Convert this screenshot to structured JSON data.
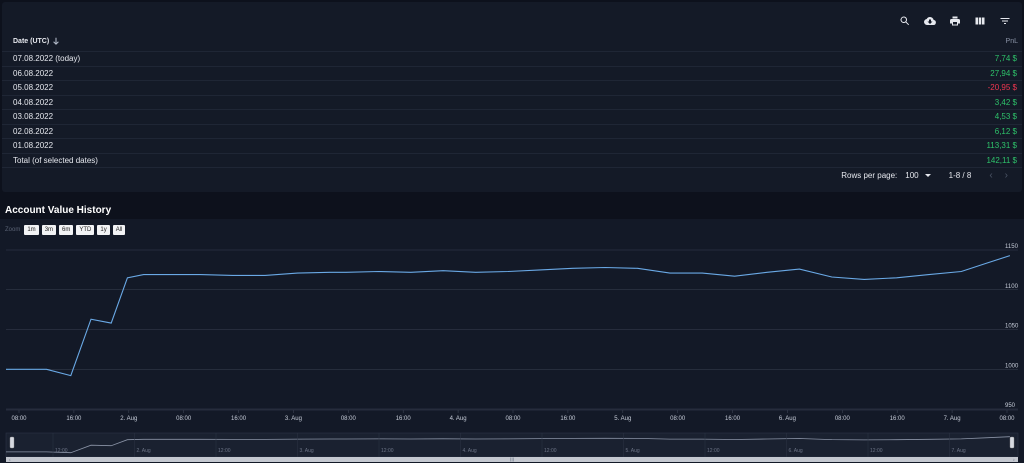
{
  "toolbar": {
    "icons": [
      "search-icon",
      "cloud-download-icon",
      "print-icon",
      "columns-icon",
      "filter-icon"
    ]
  },
  "table": {
    "header_date": "Date (UTC)",
    "header_pnl": "PnL",
    "rows": [
      {
        "date": "07.08.2022 (today)",
        "pnl": "7,74 $",
        "sign": "pos"
      },
      {
        "date": "06.08.2022",
        "pnl": "27,94 $",
        "sign": "pos"
      },
      {
        "date": "05.08.2022",
        "pnl": "-20,95 $",
        "sign": "neg"
      },
      {
        "date": "04.08.2022",
        "pnl": "3,42 $",
        "sign": "pos"
      },
      {
        "date": "03.08.2022",
        "pnl": "4,53 $",
        "sign": "pos"
      },
      {
        "date": "02.08.2022",
        "pnl": "6,12 $",
        "sign": "pos"
      },
      {
        "date": "01.08.2022",
        "pnl": "113,31 $",
        "sign": "pos"
      },
      {
        "date": "Total (of selected dates)",
        "pnl": "142,11 $",
        "sign": "pos"
      }
    ]
  },
  "pagination": {
    "rows_per_page_label": "Rows per page:",
    "rows_per_page_value": "100",
    "range": "1-8 / 8",
    "prev": "‹",
    "next": "›"
  },
  "section_title": "Account Value History",
  "zoom": {
    "label": "Zoom",
    "buttons": [
      "1m",
      "3m",
      "6m",
      "YTD",
      "1y",
      "All"
    ]
  },
  "colors": {
    "line": "#6aa9e6",
    "positive": "#2ec26a",
    "negative": "#f0364f"
  },
  "chart_data": {
    "type": "line",
    "title": "",
    "xlabel": "",
    "ylabel": "",
    "ylim": [
      950,
      1150
    ],
    "y_ticks": [
      "950",
      "1000",
      "1050",
      "1100",
      "1150"
    ],
    "x_ticks": [
      "08:00",
      "16:00",
      "2. Aug",
      "08:00",
      "16:00",
      "3. Aug",
      "08:00",
      "16:00",
      "4. Aug",
      "08:00",
      "16:00",
      "5. Aug",
      "08:00",
      "16:00",
      "6. Aug",
      "08:00",
      "16:00",
      "7. Aug",
      "08:00"
    ],
    "series": [
      {
        "x_hours": [
          0,
          5,
          8,
          10.5,
          13,
          15,
          17,
          20,
          24,
          28,
          32,
          36,
          40,
          42,
          46,
          50,
          54,
          58,
          62,
          66,
          70,
          74,
          78,
          82,
          86,
          90,
          94,
          98,
          102,
          106,
          110,
          114,
          118,
          121,
          124
        ],
        "values": [
          1000,
          1000,
          992,
          1063,
          1058,
          1115,
          1119,
          1119,
          1119,
          1118,
          1118,
          1121,
          1122,
          1122,
          1123,
          1122,
          1124,
          1122,
          1123,
          1125,
          1127,
          1128,
          1127,
          1121,
          1121,
          1117,
          1122,
          1126,
          1116,
          1113,
          1115,
          1119,
          1123,
          1133,
          1143
        ]
      }
    ],
    "navigator_labels": [
      "12:00",
      "2. Aug",
      "12:00",
      "3. Aug",
      "12:00",
      "4. Aug",
      "12:00",
      "5. Aug",
      "12:00",
      "6. Aug",
      "12:00",
      "7. Aug"
    ]
  }
}
